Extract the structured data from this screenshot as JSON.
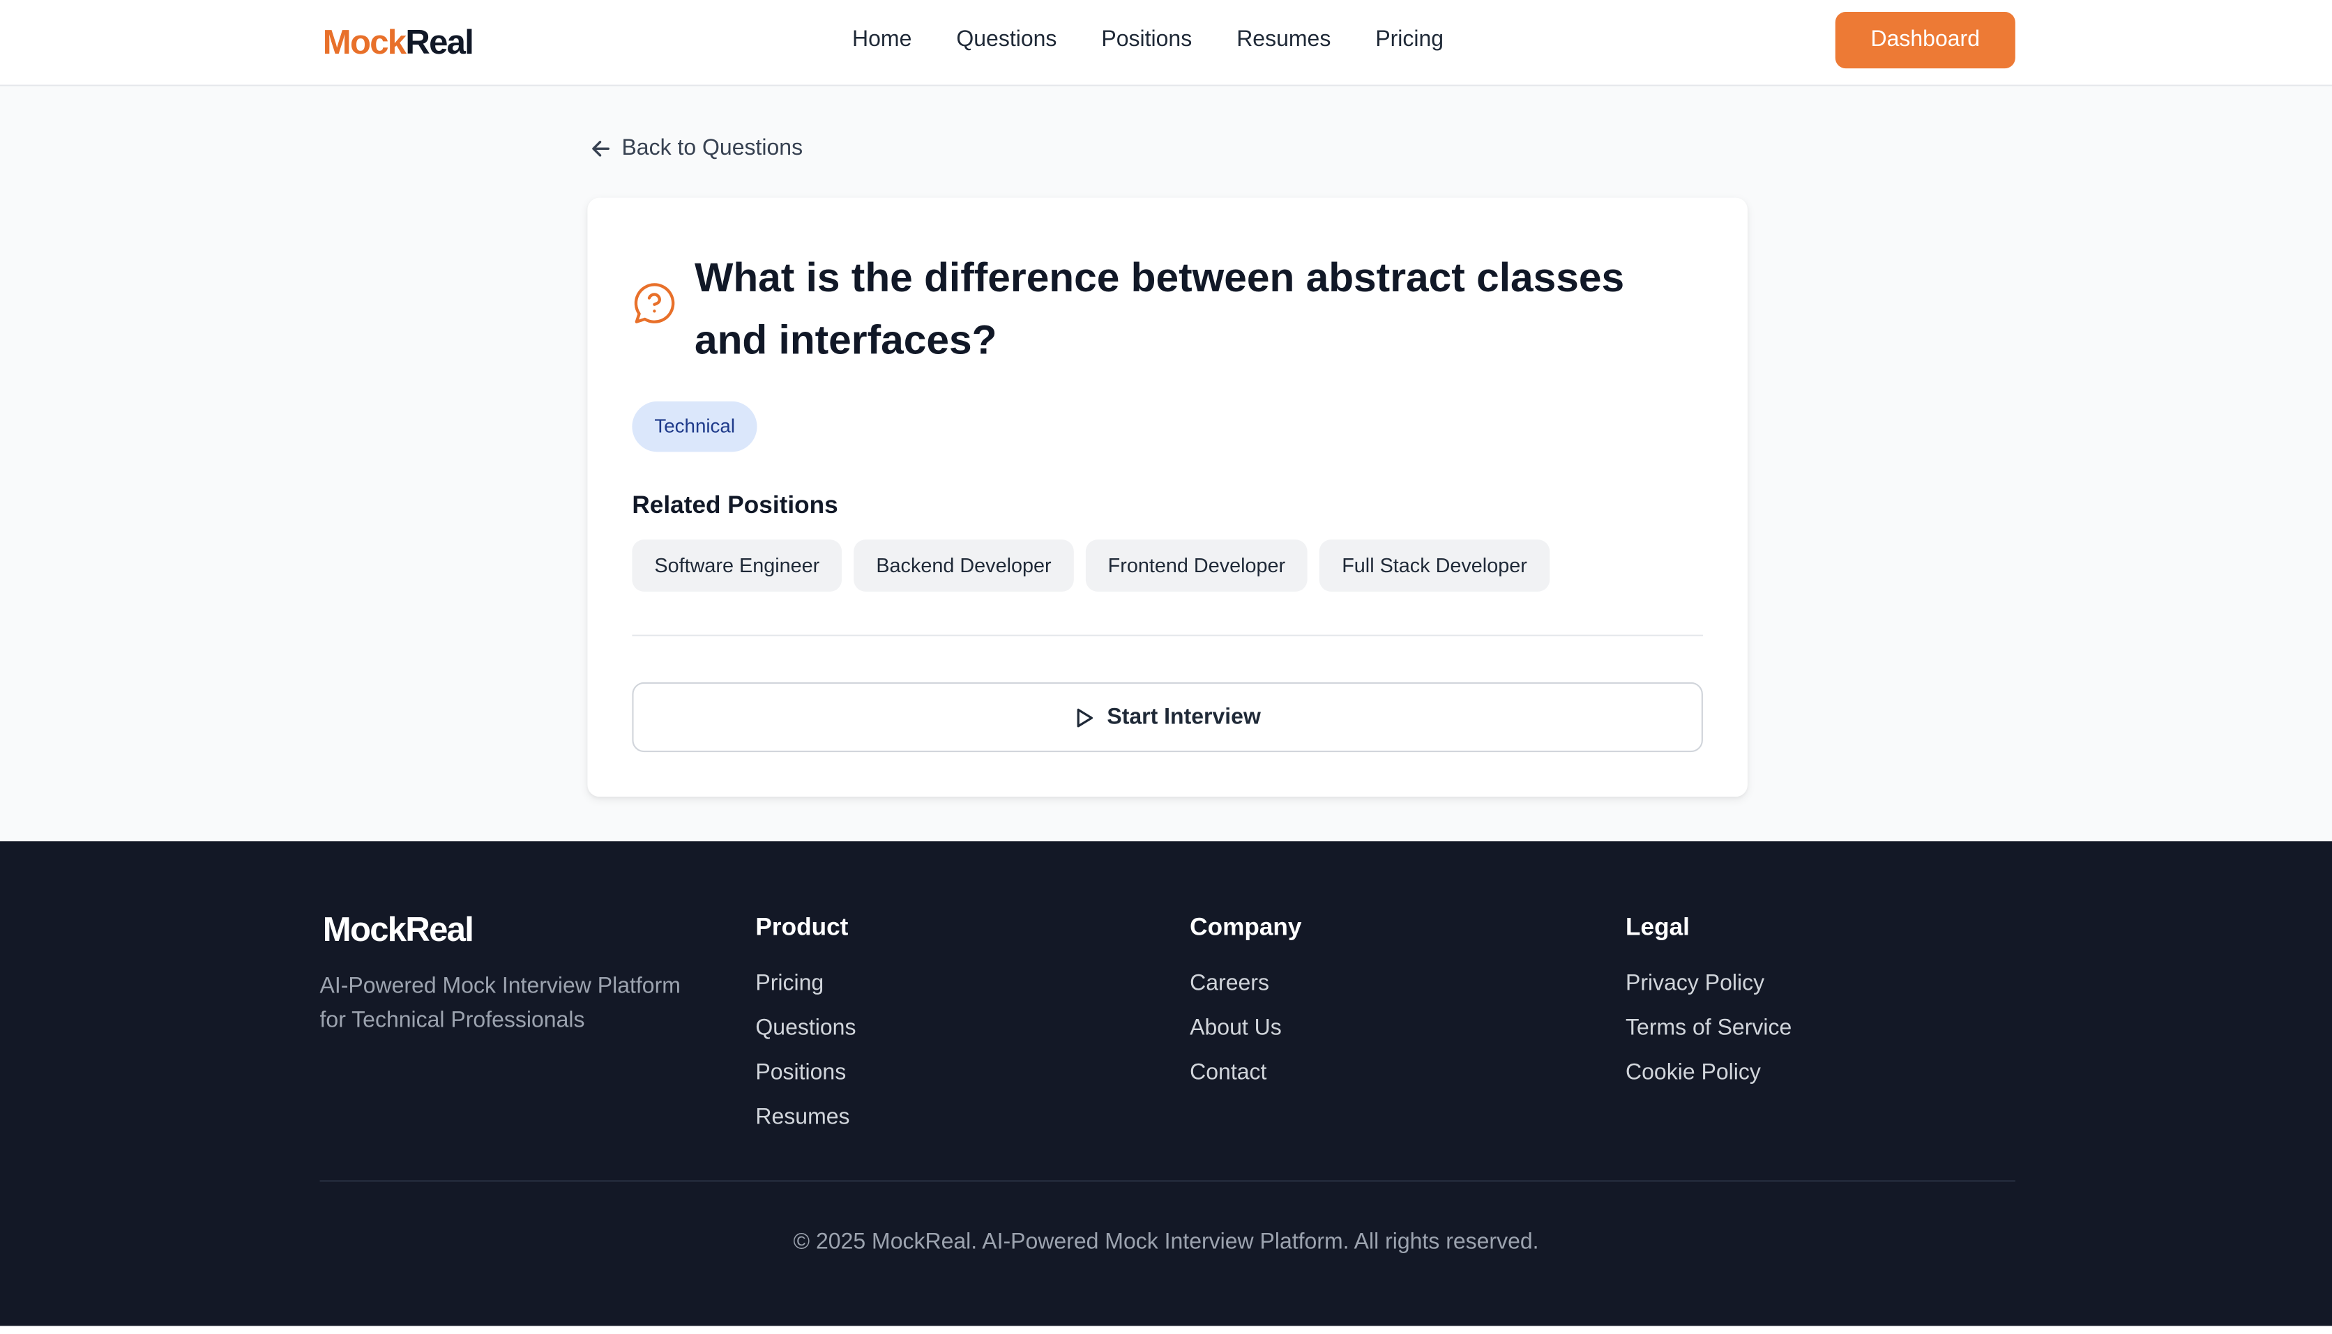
{
  "header": {
    "logo_mock": "Mock",
    "logo_real": "Real",
    "nav": [
      "Home",
      "Questions",
      "Positions",
      "Resumes",
      "Pricing"
    ],
    "dashboard_label": "Dashboard"
  },
  "main": {
    "back_label": "Back to Questions",
    "question_title": "What is the difference between abstract classes and interfaces?",
    "category_badge": "Technical",
    "related_title": "Related Positions",
    "related_positions": [
      "Software Engineer",
      "Backend Developer",
      "Frontend Developer",
      "Full Stack Developer"
    ],
    "start_label": "Start Interview"
  },
  "footer": {
    "logo": "MockReal",
    "tagline": "AI-Powered Mock Interview Platform for Technical Professionals",
    "columns": [
      {
        "title": "Product",
        "links": [
          "Pricing",
          "Questions",
          "Positions",
          "Resumes"
        ]
      },
      {
        "title": "Company",
        "links": [
          "Careers",
          "About Us",
          "Contact"
        ]
      },
      {
        "title": "Legal",
        "links": [
          "Privacy Policy",
          "Terms of Service",
          "Cookie Policy"
        ]
      }
    ],
    "copyright": "© 2025 MockReal. AI-Powered Mock Interview Platform. All rights reserved."
  },
  "colors": {
    "accent": "#ed7a35",
    "footer_bg": "#131826",
    "badge_bg": "#dbe7fb",
    "badge_text": "#1e3a8a"
  },
  "icons": {
    "back": "arrow-left-icon",
    "question": "question-bubble-icon",
    "start": "play-icon"
  }
}
